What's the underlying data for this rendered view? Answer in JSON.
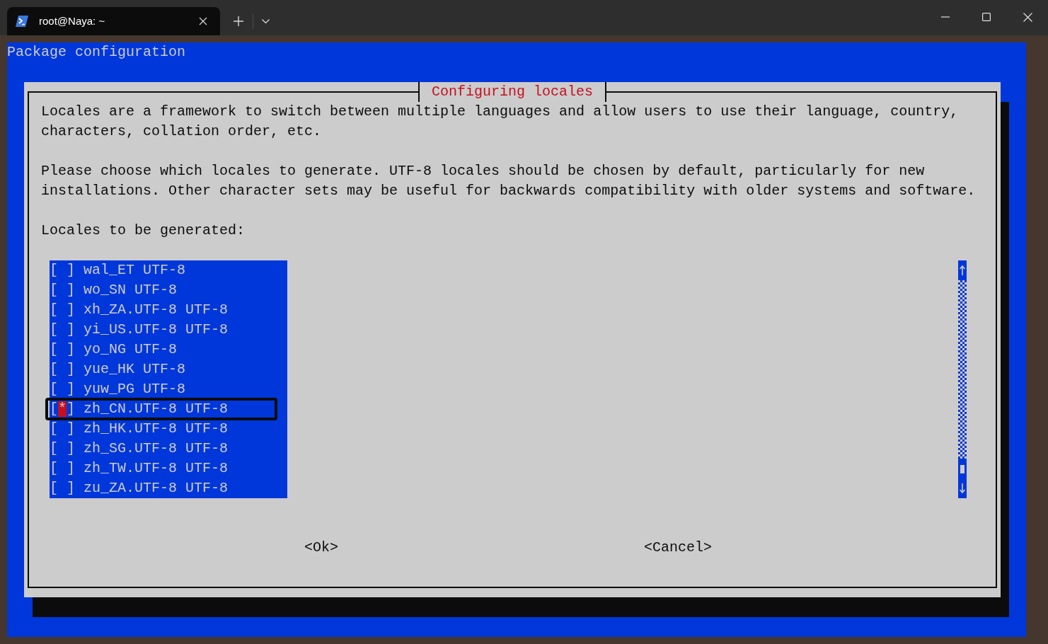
{
  "tabs": [
    {
      "title": "root@Naya: ~",
      "selected": true
    }
  ],
  "terminal": {
    "header": "Package configuration",
    "dialog": {
      "title": "Configuring locales",
      "paragraphs": [
        "Locales are a framework to switch between multiple languages and allow users to use their language, country, characters, collation order, etc.",
        "Please choose which locales to generate. UTF-8 locales should be chosen by default, particularly for new installations. Other character sets may be useful for backwards compatibility with older systems and software."
      ],
      "prompt": "Locales to be generated:",
      "list": {
        "items": [
          {
            "box": "[ ]",
            "label": "wal_ET UTF-8",
            "selected": false,
            "highlighted": false
          },
          {
            "box": "[ ]",
            "label": "wo_SN UTF-8",
            "selected": false,
            "highlighted": false
          },
          {
            "box": "[ ]",
            "label": "xh_ZA.UTF-8 UTF-8",
            "selected": false,
            "highlighted": false
          },
          {
            "box": "[ ]",
            "label": "yi_US.UTF-8 UTF-8",
            "selected": false,
            "highlighted": false
          },
          {
            "box": "[ ]",
            "label": "yo_NG UTF-8",
            "selected": false,
            "highlighted": false
          },
          {
            "box": "[ ]",
            "label": "yue_HK UTF-8",
            "selected": false,
            "highlighted": false
          },
          {
            "box": "[ ]",
            "label": "yuw_PG UTF-8",
            "selected": false,
            "highlighted": false
          },
          {
            "box": "[*]",
            "label": "zh_CN.UTF-8 UTF-8",
            "selected": true,
            "highlighted": true
          },
          {
            "box": "[ ]",
            "label": "zh_HK.UTF-8 UTF-8",
            "selected": false,
            "highlighted": false
          },
          {
            "box": "[ ]",
            "label": "zh_SG.UTF-8 UTF-8",
            "selected": false,
            "highlighted": false
          },
          {
            "box": "[ ]",
            "label": "zh_TW.UTF-8 UTF-8",
            "selected": false,
            "highlighted": false
          },
          {
            "box": "[ ]",
            "label": "zu_ZA.UTF-8 UTF-8",
            "selected": false,
            "highlighted": false
          }
        ]
      },
      "buttons": [
        "<Ok>",
        "<Cancel>"
      ]
    }
  }
}
